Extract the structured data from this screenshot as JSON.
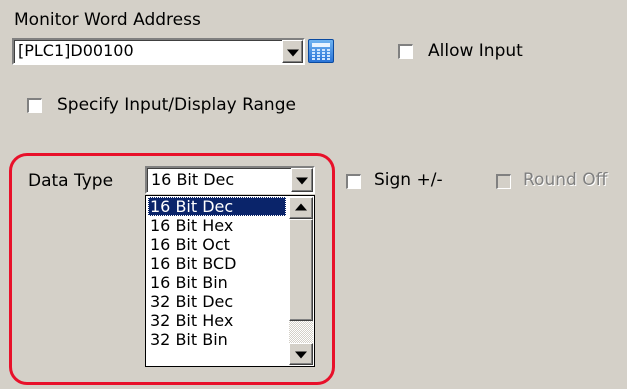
{
  "monitor_word_address": {
    "label": "Monitor Word Address",
    "value": "[PLC1]D00100"
  },
  "allow_input": {
    "label": "Allow Input",
    "checked": false
  },
  "specify_range": {
    "label": "Specify Input/Display Range",
    "checked": false
  },
  "data_type": {
    "label": "Data Type",
    "selected": "16 Bit Dec",
    "options": [
      "16 Bit Dec",
      "16 Bit Hex",
      "16 Bit Oct",
      "16 Bit BCD",
      "16 Bit Bin",
      "32 Bit Dec",
      "32 Bit Hex",
      "32 Bit Bin"
    ]
  },
  "sign": {
    "label": "Sign +/-",
    "checked": false
  },
  "round_off": {
    "label": "Round Off",
    "checked": false,
    "enabled": false
  },
  "colors": {
    "dialog_bg": "#d4d0c8",
    "selection_bg": "#0a246a",
    "highlight_border": "#e8102a"
  },
  "icons": {
    "address_picker": "calculator-icon",
    "dropdown": "chevron-down-icon",
    "scroll_up": "scroll-up-icon",
    "scroll_down": "scroll-down-icon"
  }
}
